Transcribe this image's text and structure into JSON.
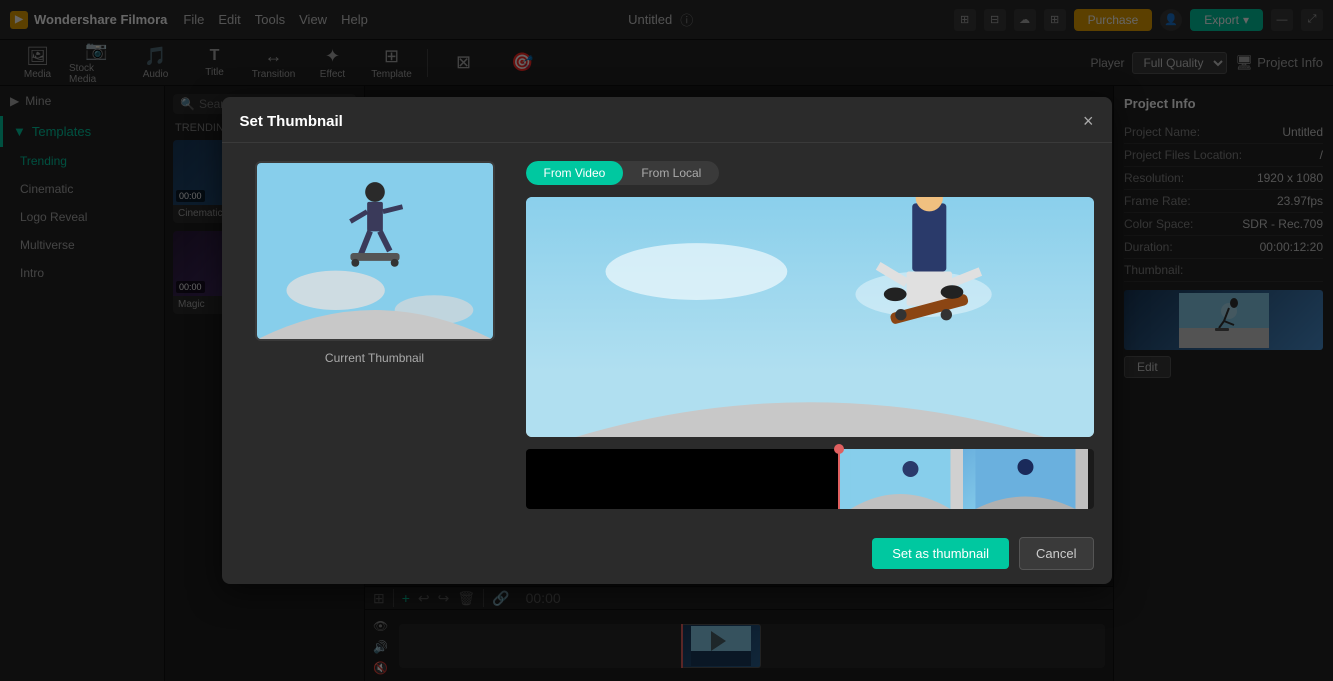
{
  "app": {
    "name": "Wondershare Filmora",
    "logo_char": "F"
  },
  "menu": {
    "items": [
      "File",
      "Edit",
      "Tools",
      "View",
      "Help"
    ]
  },
  "topbar": {
    "project_title": "Untitled",
    "purchase_label": "Purchase",
    "export_label": "Export",
    "icons": [
      "monitor-icon",
      "grid-icon",
      "cloud-icon",
      "layout-icon",
      "avatar-icon"
    ]
  },
  "toolbar2": {
    "tools": [
      {
        "label": "Media",
        "icon": "🖼"
      },
      {
        "label": "Stock Media",
        "icon": "📷"
      },
      {
        "label": "Audio",
        "icon": "🎵"
      },
      {
        "label": "Title",
        "icon": "T"
      },
      {
        "label": "Transition",
        "icon": "↔"
      },
      {
        "label": "Effect",
        "icon": "✦"
      },
      {
        "label": "Template",
        "icon": "⊞"
      },
      {
        "label": "",
        "icon": "⊠"
      },
      {
        "label": "",
        "icon": "🎯"
      }
    ],
    "player_label": "Player",
    "quality_label": "Full Quality",
    "project_info_label": "Project Info"
  },
  "sidebar": {
    "mine_label": "Mine",
    "section_label": "Templates",
    "items": [
      {
        "label": "Trending",
        "active": true
      },
      {
        "label": "Cinematic",
        "active": false
      },
      {
        "label": "Logo Reveal",
        "active": false
      },
      {
        "label": "Multiverse",
        "active": false
      },
      {
        "label": "Intro",
        "active": false
      }
    ]
  },
  "content": {
    "search_placeholder": "Search",
    "trending_label": "TRENDING",
    "cards": [
      {
        "label": "Cinematic",
        "time": "00:00"
      },
      {
        "label": "Magic",
        "time": "00:00"
      }
    ]
  },
  "modal": {
    "title": "Set Thumbnail",
    "close_label": "×",
    "tabs": [
      {
        "label": "From Video",
        "active": true
      },
      {
        "label": "From Local",
        "active": false
      }
    ],
    "current_thumb_label": "Current Thumbnail",
    "set_thumb_label": "Set as thumbnail",
    "cancel_label": "Cancel"
  },
  "right_panel": {
    "title": "Project Info",
    "rows": [
      {
        "label": "Project Name:",
        "value": "Untitled"
      },
      {
        "label": "Project Files Location:",
        "value": "/"
      },
      {
        "label": "Resolution:",
        "value": "1920 x 1080"
      },
      {
        "label": "Frame Rate:",
        "value": "23.97fps"
      },
      {
        "label": "Color Space:",
        "value": "SDR - Rec.709"
      },
      {
        "label": "Duration:",
        "value": "00:00:12:20"
      },
      {
        "label": "Thumbnail:",
        "value": ""
      }
    ],
    "edit_label": "Edit"
  },
  "timeline": {
    "time_label": "00:00",
    "icons": [
      "grid-icon",
      "add-icon",
      "undo-icon",
      "redo-icon",
      "trash-icon",
      "link-icon",
      "eye-icon",
      "audio-icon",
      "mute-icon"
    ]
  }
}
